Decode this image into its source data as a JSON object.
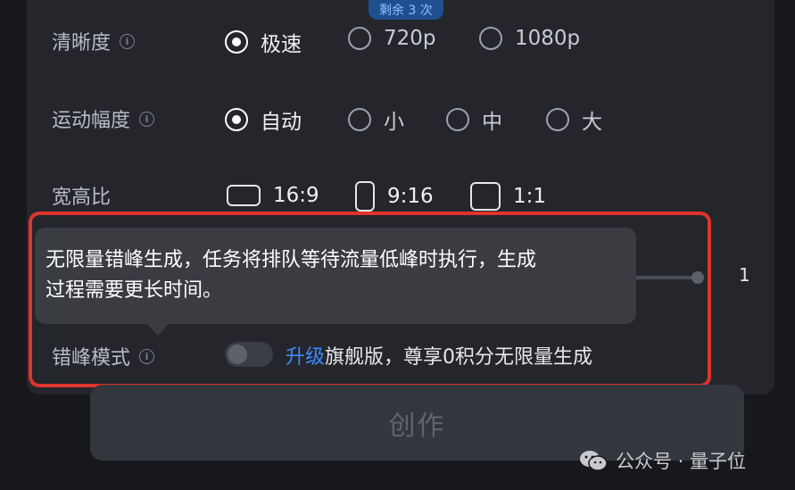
{
  "badge": "剩余 3 次",
  "clarity": {
    "label": "清晰度",
    "options": [
      {
        "label": "极速",
        "selected": true
      },
      {
        "label": "720p",
        "selected": false
      },
      {
        "label": "1080p",
        "selected": false
      }
    ]
  },
  "motion": {
    "label": "运动幅度",
    "options": [
      {
        "label": "自动",
        "selected": true
      },
      {
        "label": "小",
        "selected": false
      },
      {
        "label": "中",
        "selected": false
      },
      {
        "label": "大",
        "selected": false
      }
    ]
  },
  "aspect": {
    "label": "宽高比",
    "options": [
      {
        "label": "16:9"
      },
      {
        "label": "9:16"
      },
      {
        "label": "1:1"
      }
    ]
  },
  "slider": {
    "value": "1"
  },
  "tooltip": {
    "line1": "无限量错峰生成，任务将排队等待流量低峰时执行，生成",
    "line2": "过程需要更长时间。"
  },
  "offpeak": {
    "label": "错峰模式",
    "enabled": false,
    "upgrade_link": "升级",
    "upgrade_text": "旗舰版，尊享0积分无限量生成"
  },
  "create_button": "创作",
  "watermark": "公众号 · 量子位",
  "colors": {
    "accent": "#3d8bff",
    "highlight": "#e0342f",
    "background": "#17181c",
    "panel": "#24262b"
  }
}
